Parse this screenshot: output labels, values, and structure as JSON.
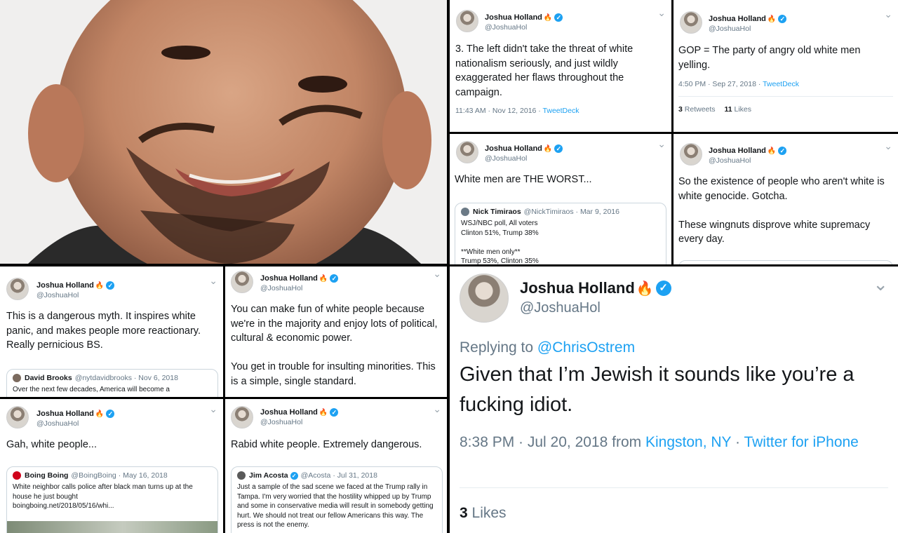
{
  "author": {
    "name": "Joshua Holland",
    "handle": "@JoshuaHol"
  },
  "tweets": [
    {
      "text": "3. The left didn't take the threat of white nationalism seriously, and just wildly exaggerated her flaws throughout the campaign.",
      "time": "11:43 AM · Nov 12, 2016 · ",
      "source": "TweetDeck"
    },
    {
      "text": "GOP = The party of angry old white men yelling.",
      "time": "4:50 PM · Sep 27, 2018 · ",
      "source": "TweetDeck",
      "retweets_count": "3",
      "retweets_label": "Retweets",
      "likes_count": "11",
      "likes_label": "Likes"
    },
    {
      "text": "White men are THE WORST...",
      "quote": {
        "name": "Nick Timiraos",
        "handle": "@NickTimiraos · Mar 9, 2016",
        "text": "WSJ/NBC poll, All voters\nClinton 51%, Trump 38%\n\n**White men only**\nTrump 53%, Clinton 35%"
      }
    },
    {
      "text": "So the existence of people who aren't white is white genocide. Gotcha.\n\nThese wingnuts disprove white supremacy every day."
    },
    {
      "text": "This is a dangerous myth. It inspires white panic, and makes people more reactionary. Really pernicious BS.",
      "quote": {
        "name": "David Brooks",
        "handle": "@nytdavidbrooks · Nov 6, 2018",
        "text": "Over the next few decades, America will become a"
      }
    },
    {
      "text": "You can make fun of white people because we're in the majority and enjoy lots of political, cultural & economic power.\n\nYou get in trouble for insulting minorities. This is a simple, single standard."
    },
    {
      "text": "Gah, white people...",
      "quote": {
        "name": "Boing Boing",
        "handle": "@BoingBoing · May 16, 2018",
        "text": "White neighbor calls police after black man turns up at the house he just bought\nboingboing.net/2018/05/16/whi..."
      }
    },
    {
      "text": "Rabid white people. Extremely dangerous.",
      "quote": {
        "name": "Jim Acosta",
        "handle": "@Acosta · Jul 31, 2018",
        "text": "Just a sample of the sad scene we faced at the Trump rally in Tampa. I'm very worried that the hostility whipped up by Trump and some in conservative media will result in somebody getting hurt. We should not treat our fellow Americans this way. The press is not the enemy."
      }
    },
    {
      "reply_prefix": "Replying to ",
      "reply_to": "@ChrisOstrem",
      "text": "Given that I’m Jewish it sounds like you’re a fucking idiot.",
      "time": "8:38 PM · Jul 20, 2018 from ",
      "location": "Kingston, NY",
      "sep": " · ",
      "source": "Twitter for iPhone",
      "likes_count": "3",
      "likes_label": "Likes"
    }
  ],
  "icons": {
    "fire": "🔥",
    "verified": "✓",
    "chevron": "⌄"
  },
  "colors": {
    "link": "#1da1f2",
    "verified": "#1da1f2",
    "muted": "#657786"
  }
}
